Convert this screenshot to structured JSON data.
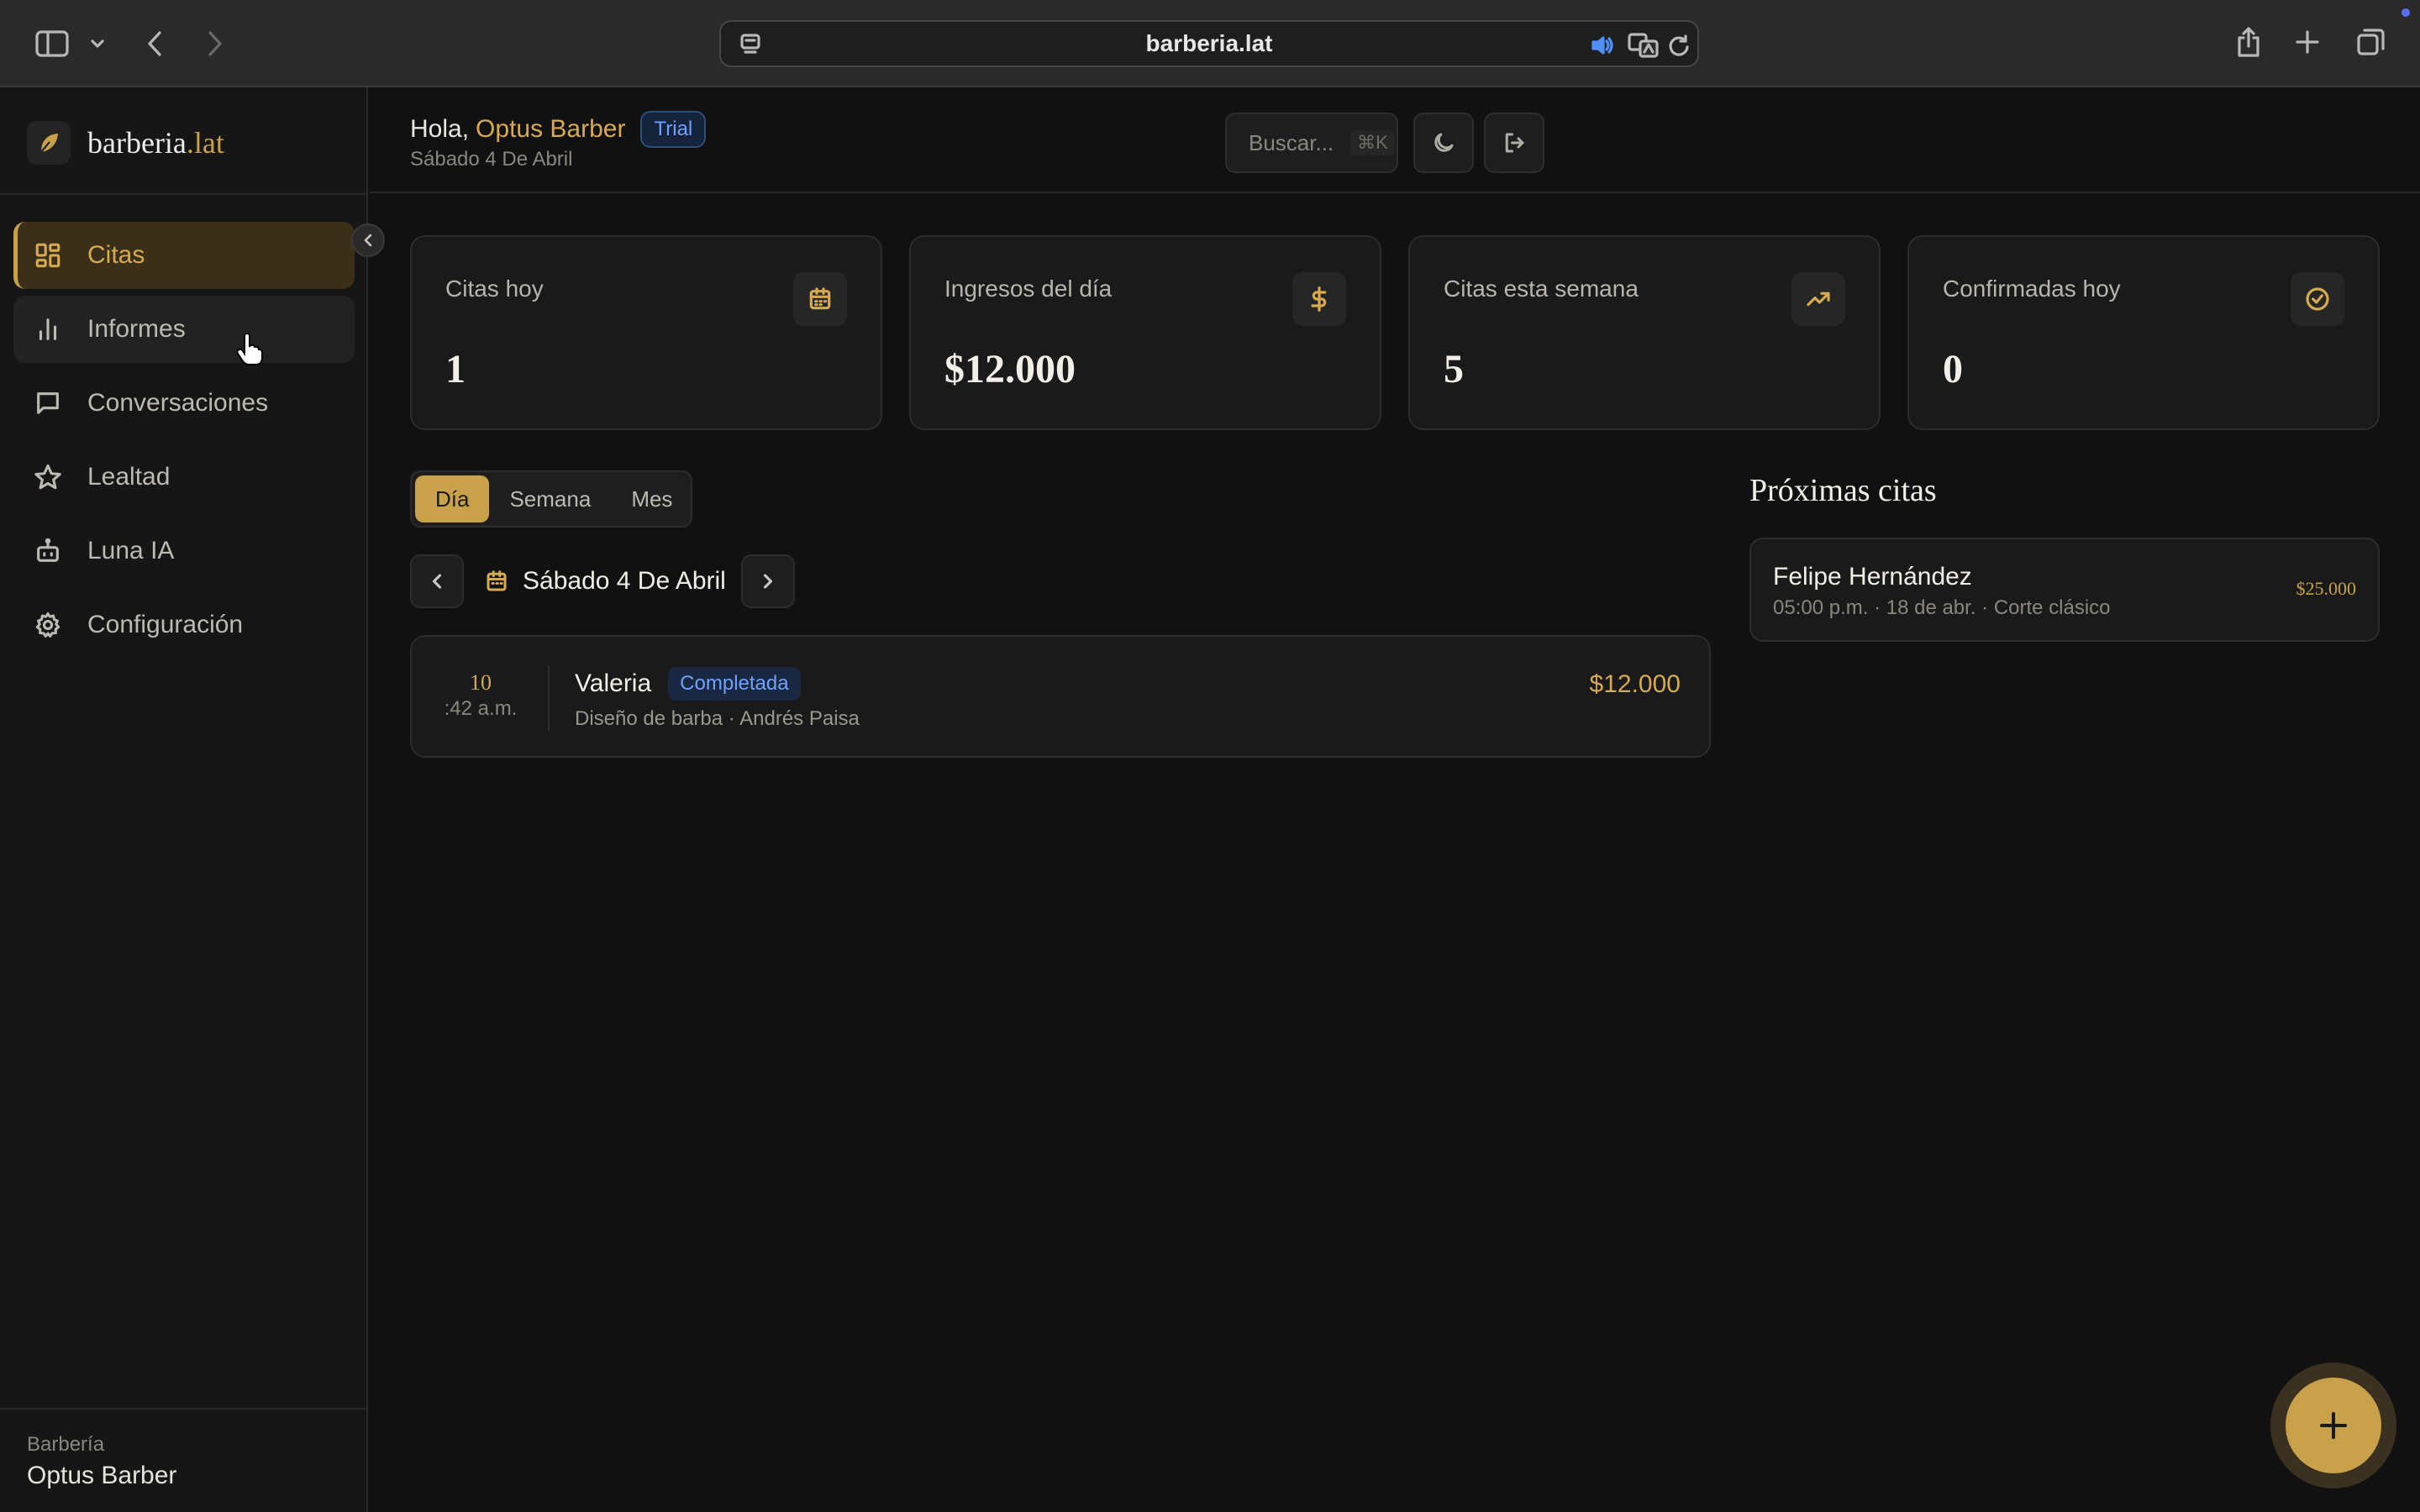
{
  "browser": {
    "url": "barberia.lat"
  },
  "sidebar": {
    "brand_main": "barberia",
    "brand_tld": ".lat",
    "items": [
      {
        "label": "Citas",
        "icon": "grid-icon"
      },
      {
        "label": "Informes",
        "icon": "bar-chart-icon"
      },
      {
        "label": "Conversaciones",
        "icon": "chat-icon"
      },
      {
        "label": "Lealtad",
        "icon": "star-icon"
      },
      {
        "label": "Luna IA",
        "icon": "robot-icon"
      },
      {
        "label": "Configuración",
        "icon": "gear-icon"
      }
    ],
    "footer_caption": "Barbería",
    "footer_name": "Optus Barber"
  },
  "header": {
    "greeting": "Hola,",
    "user_name": "Optus Barber",
    "plan_badge": "Trial",
    "date": "Sábado 4 De Abril",
    "search_placeholder": "Buscar...",
    "search_shortcut": "⌘K"
  },
  "stats": [
    {
      "label": "Citas hoy",
      "value": "1",
      "icon": "calendar-icon"
    },
    {
      "label": "Ingresos del día",
      "value": "$12.000",
      "icon": "dollar-icon"
    },
    {
      "label": "Citas esta semana",
      "value": "5",
      "icon": "trending-up-icon"
    },
    {
      "label": "Confirmadas hoy",
      "value": "0",
      "icon": "check-circle-icon"
    }
  ],
  "view_tabs": {
    "day": "Día",
    "week": "Semana",
    "month": "Mes",
    "selected": "Día"
  },
  "date_nav": {
    "current": "Sábado 4 De Abril"
  },
  "appointments": [
    {
      "hour": "10",
      "minutes": ":42 a.m.",
      "client": "Valeria",
      "status": "Completada",
      "detail": "Diseño de barba · Andrés Paisa",
      "price": "$12.000"
    }
  ],
  "upcoming": {
    "title": "Próximas citas",
    "items": [
      {
        "name": "Felipe Hernández",
        "detail": "05:00 p.m. · 18 de abr. · Corte clásico",
        "price": "$25.000"
      }
    ]
  },
  "colors": {
    "accent": "#c9a14a",
    "background": "#111111",
    "status_blue": "#6fa2ff"
  }
}
